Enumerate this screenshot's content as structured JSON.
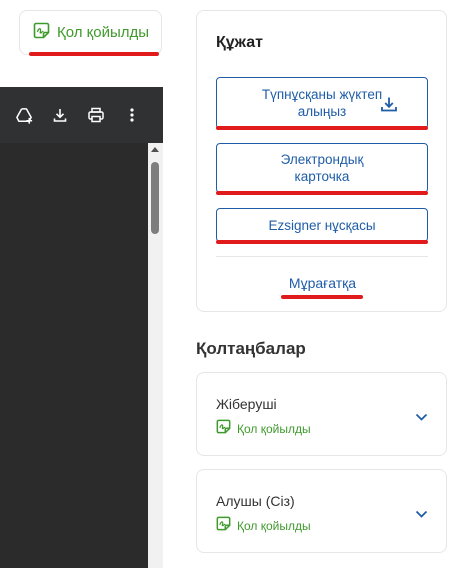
{
  "signed_badge": {
    "label": "Қол қойылды",
    "icon": "signed-doc-icon"
  },
  "viewer": {
    "toolbar": [
      {
        "icon": "drive-add-icon"
      },
      {
        "icon": "download-icon"
      },
      {
        "icon": "print-icon"
      },
      {
        "icon": "more-vert-icon"
      }
    ]
  },
  "document": {
    "title": "Құжат",
    "download_original_label": "Түпнұсқаны жүктеп алыңыз",
    "electronic_card_label": "Электрондық карточка",
    "ezsigner_label": "Ezsigner нұсқасы",
    "archive_label": "Мұрағатқа"
  },
  "signatures": {
    "heading": "Қолтаңбалар",
    "parties": [
      {
        "role": "Жіберуші",
        "status": "Қол қойылды"
      },
      {
        "role": "Алушы (Сіз)",
        "status": "Қол қойылды"
      }
    ]
  },
  "colors": {
    "accent": "#1f5da8",
    "signed_green": "#3f9a2c",
    "annotation_red": "#e11b1b",
    "viewer_dark": "#2f3133"
  }
}
